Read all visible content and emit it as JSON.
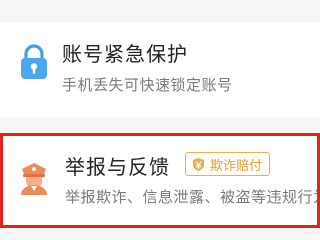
{
  "emergency": {
    "icon": "lock-icon",
    "icon_color": "#3fa0e8",
    "title": "账号紧急保护",
    "subtitle": "手机丢失可快速锁定账号"
  },
  "report": {
    "icon": "police-icon",
    "icon_color": "#f08a5d",
    "highlight_color": "#e2231a",
    "title": "举报与反馈",
    "badge": {
      "icon": "shield-icon",
      "text": "欺诈赔付",
      "color": "#e0a038"
    },
    "subtitle": "举报欺诈、信息泄露、被盗等违规行为"
  }
}
